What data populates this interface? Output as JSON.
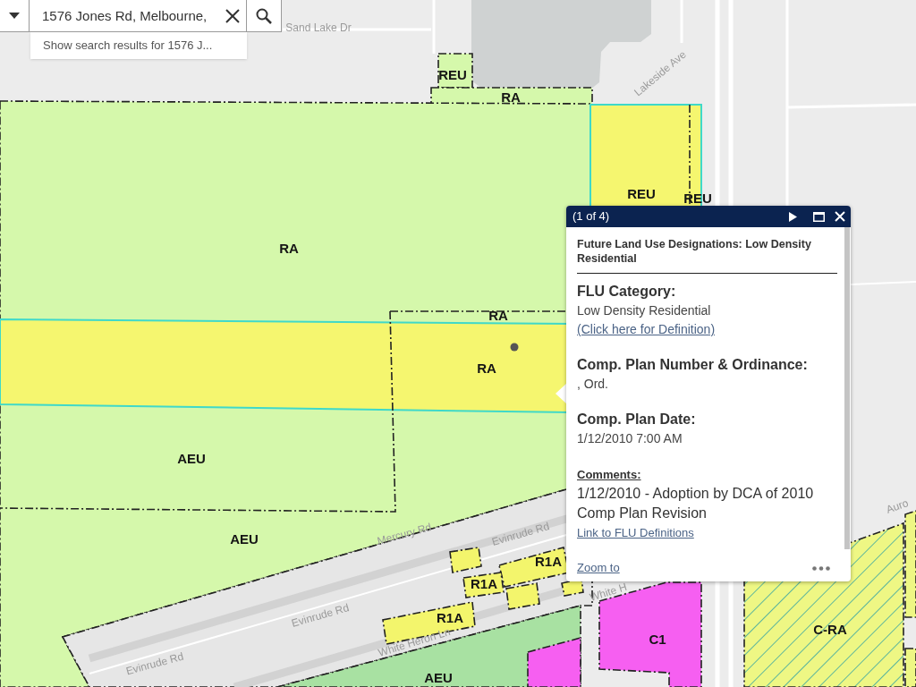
{
  "search": {
    "value": "1576 Jones Rd, Melbourne,",
    "suggestion": "Show search results for 1576 J..."
  },
  "map": {
    "zone_labels": [
      "REU",
      "RA",
      "REU",
      "REU",
      "RA",
      "RA",
      "RA",
      "AEU",
      "AEU",
      "R1A",
      "R1A",
      "R1A",
      "C1",
      "C-RA",
      "AEU"
    ],
    "street_labels": [
      "Sand Lake Dr",
      "Lakeside Ave",
      "Mercury Rd",
      "Evinrude Rd",
      "Evinrude Rd",
      "Evinrude Rd",
      "White Heron Ln",
      "White H",
      "Auro"
    ]
  },
  "popup": {
    "counter": "(1 of 4)",
    "title": "Future Land Use Designations: Low Density Residential",
    "fields": [
      {
        "label": "FLU Category:",
        "value": "Low Density Residential",
        "link": "(Click here for Definition)"
      },
      {
        "label": "Comp. Plan Number & Ordinance:",
        "value": ", Ord."
      },
      {
        "label": "Comp. Plan Date:",
        "value": "1/12/2010 7:00 AM"
      }
    ],
    "comments": {
      "label": "Comments:",
      "text": "1/12/2010 - Adoption by DCA of 2010 Comp Plan Revision",
      "link": "Link to FLU Definitions"
    },
    "zoom_link": "Zoom to"
  }
}
